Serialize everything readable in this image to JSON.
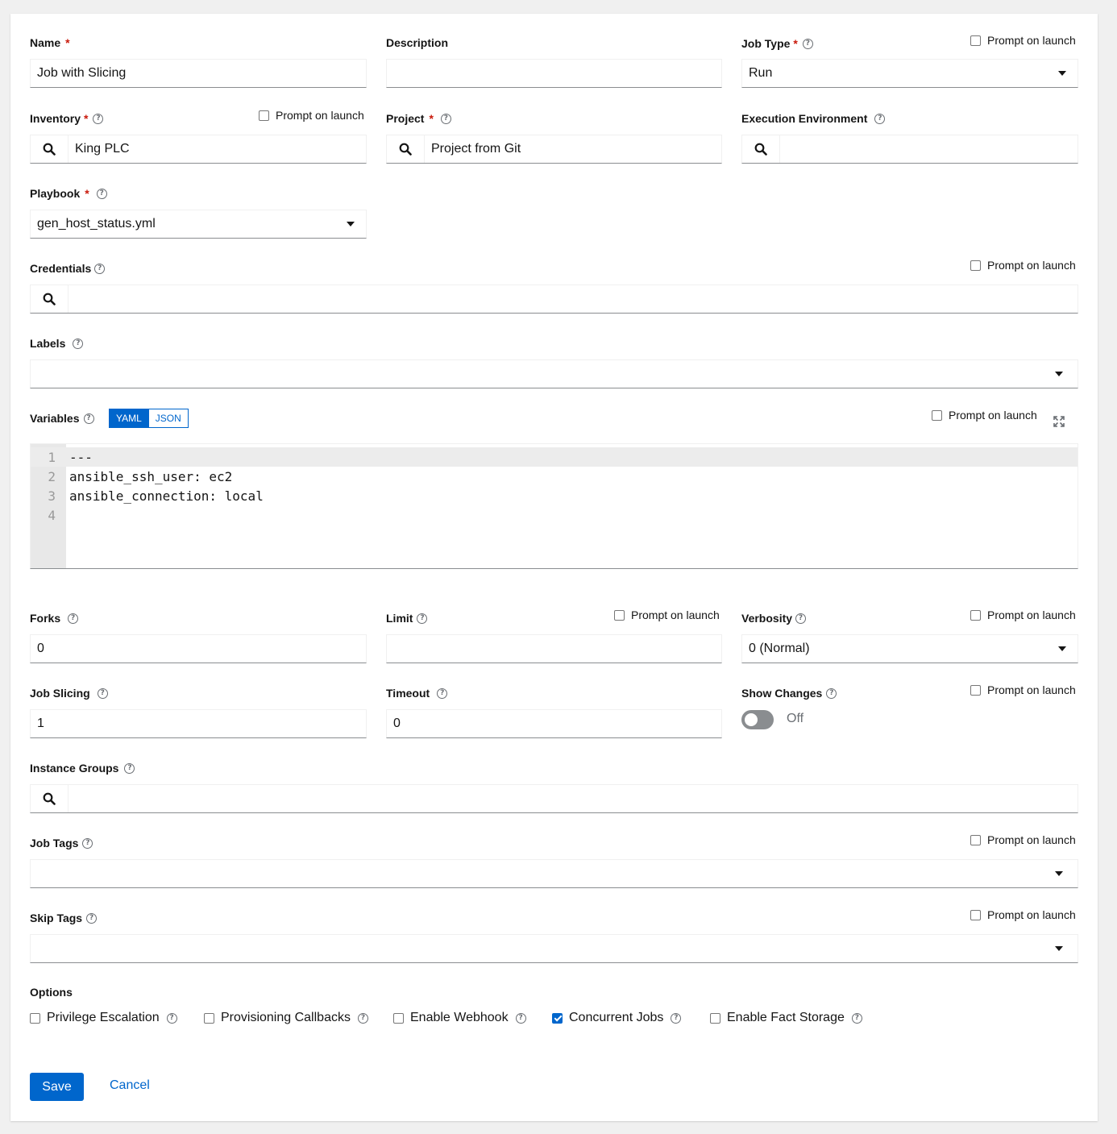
{
  "prompt_label": "Prompt on launch",
  "name": {
    "label": "Name",
    "value": "Job with Slicing"
  },
  "description": {
    "label": "Description",
    "value": ""
  },
  "job_type": {
    "label": "Job Type",
    "value": "Run"
  },
  "inventory": {
    "label": "Inventory",
    "value": "King PLC"
  },
  "project": {
    "label": "Project",
    "value": "Project from Git"
  },
  "execution_environment": {
    "label": "Execution Environment",
    "value": ""
  },
  "playbook": {
    "label": "Playbook",
    "value": "gen_host_status.yml"
  },
  "credentials": {
    "label": "Credentials",
    "value": ""
  },
  "labels": {
    "label": "Labels",
    "value": ""
  },
  "variables": {
    "label": "Variables",
    "modes": [
      "YAML",
      "JSON"
    ],
    "active_mode": "YAML",
    "lines": [
      {
        "num": "1",
        "text": "---"
      },
      {
        "num": "2",
        "text": "ansible_ssh_user: ec2"
      },
      {
        "num": "3",
        "text": "ansible_connection: local"
      },
      {
        "num": "4",
        "text": ""
      }
    ]
  },
  "forks": {
    "label": "Forks",
    "value": "0"
  },
  "limit": {
    "label": "Limit",
    "value": ""
  },
  "verbosity": {
    "label": "Verbosity",
    "value": "0 (Normal)"
  },
  "job_slicing": {
    "label": "Job Slicing",
    "value": "1"
  },
  "timeout": {
    "label": "Timeout",
    "value": "0"
  },
  "show_changes": {
    "label": "Show Changes",
    "state": "Off"
  },
  "instance_groups": {
    "label": "Instance Groups",
    "value": ""
  },
  "job_tags": {
    "label": "Job Tags",
    "value": ""
  },
  "skip_tags": {
    "label": "Skip Tags",
    "value": ""
  },
  "options": {
    "label": "Options",
    "items": [
      {
        "label": "Privilege Escalation",
        "checked": false
      },
      {
        "label": "Provisioning Callbacks",
        "checked": false
      },
      {
        "label": "Enable Webhook",
        "checked": false
      },
      {
        "label": "Concurrent Jobs",
        "checked": true
      },
      {
        "label": "Enable Fact Storage",
        "checked": false
      }
    ]
  },
  "actions": {
    "save": "Save",
    "cancel": "Cancel"
  },
  "colors": {
    "primary": "#0066cc",
    "required": "#c9190b",
    "toggle_off": "#8a8d90"
  }
}
